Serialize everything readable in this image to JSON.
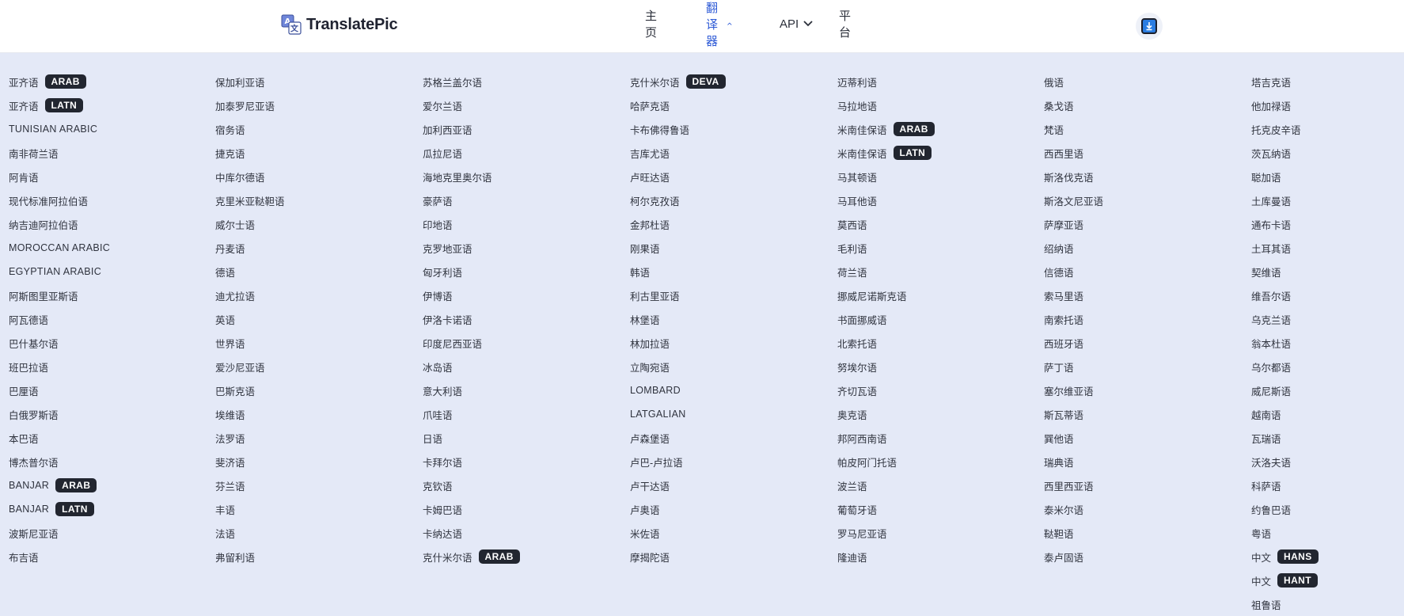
{
  "brand": {
    "name": "TranslatePic"
  },
  "nav": {
    "items": [
      {
        "label": "主页",
        "active": false,
        "chevron": ""
      },
      {
        "label": "翻译器",
        "active": true,
        "chevron": "⌃"
      },
      {
        "label": "API",
        "active": false,
        "chevron": "⌄"
      },
      {
        "label": "平台",
        "active": false,
        "chevron": ""
      }
    ],
    "download_icon": "download-icon"
  },
  "colors": {
    "accent": "#2f5bd6",
    "badge_bg": "#222630",
    "menu_bg": "#e4e9f7"
  },
  "columns": [
    [
      {
        "name": "亚齐语",
        "badge": "ARAB"
      },
      {
        "name": "亚齐语",
        "badge": "LATN"
      },
      {
        "name": "Tunisian Arabic",
        "badge": ""
      },
      {
        "name": "南非荷兰语",
        "badge": ""
      },
      {
        "name": "阿肯语",
        "badge": ""
      },
      {
        "name": "现代标准阿拉伯语",
        "badge": ""
      },
      {
        "name": "纳吉迪阿拉伯语",
        "badge": ""
      },
      {
        "name": "Moroccan Arabic",
        "badge": ""
      },
      {
        "name": "Egyptian Arabic",
        "badge": ""
      },
      {
        "name": "阿斯图里亚斯语",
        "badge": ""
      },
      {
        "name": "阿瓦德语",
        "badge": ""
      },
      {
        "name": "巴什基尔语",
        "badge": ""
      },
      {
        "name": "班巴拉语",
        "badge": ""
      },
      {
        "name": "巴厘语",
        "badge": ""
      },
      {
        "name": "白俄罗斯语",
        "badge": ""
      },
      {
        "name": "本巴语",
        "badge": ""
      },
      {
        "name": "博杰普尔语",
        "badge": ""
      },
      {
        "name": "Banjar",
        "badge": "ARAB"
      },
      {
        "name": "Banjar",
        "badge": "LATN"
      },
      {
        "name": "波斯尼亚语",
        "badge": ""
      },
      {
        "name": "布吉语",
        "badge": ""
      }
    ],
    [
      {
        "name": "保加利亚语",
        "badge": ""
      },
      {
        "name": "加泰罗尼亚语",
        "badge": ""
      },
      {
        "name": "宿务语",
        "badge": ""
      },
      {
        "name": "捷克语",
        "badge": ""
      },
      {
        "name": "中库尔德语",
        "badge": ""
      },
      {
        "name": "克里米亚鞑靼语",
        "badge": ""
      },
      {
        "name": "威尔士语",
        "badge": ""
      },
      {
        "name": "丹麦语",
        "badge": ""
      },
      {
        "name": "德语",
        "badge": ""
      },
      {
        "name": "迪尤拉语",
        "badge": ""
      },
      {
        "name": "英语",
        "badge": ""
      },
      {
        "name": "世界语",
        "badge": ""
      },
      {
        "name": "爱沙尼亚语",
        "badge": ""
      },
      {
        "name": "巴斯克语",
        "badge": ""
      },
      {
        "name": "埃维语",
        "badge": ""
      },
      {
        "name": "法罗语",
        "badge": ""
      },
      {
        "name": "斐济语",
        "badge": ""
      },
      {
        "name": "芬兰语",
        "badge": ""
      },
      {
        "name": "丰语",
        "badge": ""
      },
      {
        "name": "法语",
        "badge": ""
      },
      {
        "name": "弗留利语",
        "badge": ""
      }
    ],
    [
      {
        "name": "苏格兰盖尔语",
        "badge": ""
      },
      {
        "name": "爱尔兰语",
        "badge": ""
      },
      {
        "name": "加利西亚语",
        "badge": ""
      },
      {
        "name": "瓜拉尼语",
        "badge": ""
      },
      {
        "name": "海地克里奥尔语",
        "badge": ""
      },
      {
        "name": "豪萨语",
        "badge": ""
      },
      {
        "name": "印地语",
        "badge": ""
      },
      {
        "name": "克罗地亚语",
        "badge": ""
      },
      {
        "name": "匈牙利语",
        "badge": ""
      },
      {
        "name": "伊博语",
        "badge": ""
      },
      {
        "name": "伊洛卡诺语",
        "badge": ""
      },
      {
        "name": "印度尼西亚语",
        "badge": ""
      },
      {
        "name": "冰岛语",
        "badge": ""
      },
      {
        "name": "意大利语",
        "badge": ""
      },
      {
        "name": "爪哇语",
        "badge": ""
      },
      {
        "name": "日语",
        "badge": ""
      },
      {
        "name": "卡拜尔语",
        "badge": ""
      },
      {
        "name": "克钦语",
        "badge": ""
      },
      {
        "name": "卡姆巴语",
        "badge": ""
      },
      {
        "name": "卡纳达语",
        "badge": ""
      },
      {
        "name": "克什米尔语",
        "badge": "ARAB"
      }
    ],
    [
      {
        "name": "克什米尔语",
        "badge": "DEVA"
      },
      {
        "name": "哈萨克语",
        "badge": ""
      },
      {
        "name": "卡布佛得鲁语",
        "badge": ""
      },
      {
        "name": "吉库尤语",
        "badge": ""
      },
      {
        "name": "卢旺达语",
        "badge": ""
      },
      {
        "name": "柯尔克孜语",
        "badge": ""
      },
      {
        "name": "金邦杜语",
        "badge": ""
      },
      {
        "name": "刚果语",
        "badge": ""
      },
      {
        "name": "韩语",
        "badge": ""
      },
      {
        "name": "利古里亚语",
        "badge": ""
      },
      {
        "name": "林堡语",
        "badge": ""
      },
      {
        "name": "林加拉语",
        "badge": ""
      },
      {
        "name": "立陶宛语",
        "badge": ""
      },
      {
        "name": "Lombard",
        "badge": ""
      },
      {
        "name": "Latgalian",
        "badge": ""
      },
      {
        "name": "卢森堡语",
        "badge": ""
      },
      {
        "name": "卢巴-卢拉语",
        "badge": ""
      },
      {
        "name": "卢干达语",
        "badge": ""
      },
      {
        "name": "卢奥语",
        "badge": ""
      },
      {
        "name": "米佐语",
        "badge": ""
      },
      {
        "name": "摩揭陀语",
        "badge": ""
      }
    ],
    [
      {
        "name": "迈蒂利语",
        "badge": ""
      },
      {
        "name": "马拉地语",
        "badge": ""
      },
      {
        "name": "米南佳保语",
        "badge": "ARAB"
      },
      {
        "name": "米南佳保语",
        "badge": "LATN"
      },
      {
        "name": "马其顿语",
        "badge": ""
      },
      {
        "name": "马耳他语",
        "badge": ""
      },
      {
        "name": "莫西语",
        "badge": ""
      },
      {
        "name": "毛利语",
        "badge": ""
      },
      {
        "name": "荷兰语",
        "badge": ""
      },
      {
        "name": "挪威尼诺斯克语",
        "badge": ""
      },
      {
        "name": "书面挪威语",
        "badge": ""
      },
      {
        "name": "北索托语",
        "badge": ""
      },
      {
        "name": "努埃尔语",
        "badge": ""
      },
      {
        "name": "齐切瓦语",
        "badge": ""
      },
      {
        "name": "奥克语",
        "badge": ""
      },
      {
        "name": "邦阿西南语",
        "badge": ""
      },
      {
        "name": "帕皮阿门托语",
        "badge": ""
      },
      {
        "name": "波兰语",
        "badge": ""
      },
      {
        "name": "葡萄牙语",
        "badge": ""
      },
      {
        "name": "罗马尼亚语",
        "badge": ""
      },
      {
        "name": "隆迪语",
        "badge": ""
      }
    ],
    [
      {
        "name": "俄语",
        "badge": ""
      },
      {
        "name": "桑戈语",
        "badge": ""
      },
      {
        "name": "梵语",
        "badge": ""
      },
      {
        "name": "西西里语",
        "badge": ""
      },
      {
        "name": "斯洛伐克语",
        "badge": ""
      },
      {
        "name": "斯洛文尼亚语",
        "badge": ""
      },
      {
        "name": "萨摩亚语",
        "badge": ""
      },
      {
        "name": "绍纳语",
        "badge": ""
      },
      {
        "name": "信德语",
        "badge": ""
      },
      {
        "name": "索马里语",
        "badge": ""
      },
      {
        "name": "南索托语",
        "badge": ""
      },
      {
        "name": "西班牙语",
        "badge": ""
      },
      {
        "name": "萨丁语",
        "badge": ""
      },
      {
        "name": "塞尔维亚语",
        "badge": ""
      },
      {
        "name": "斯瓦蒂语",
        "badge": ""
      },
      {
        "name": "巽他语",
        "badge": ""
      },
      {
        "name": "瑞典语",
        "badge": ""
      },
      {
        "name": "西里西亚语",
        "badge": ""
      },
      {
        "name": "泰米尔语",
        "badge": ""
      },
      {
        "name": "鞑靼语",
        "badge": ""
      },
      {
        "name": "泰卢固语",
        "badge": ""
      }
    ],
    [
      {
        "name": "塔吉克语",
        "badge": ""
      },
      {
        "name": "他加禄语",
        "badge": ""
      },
      {
        "name": "托克皮辛语",
        "badge": ""
      },
      {
        "name": "茨瓦纳语",
        "badge": ""
      },
      {
        "name": "聪加语",
        "badge": ""
      },
      {
        "name": "土库曼语",
        "badge": ""
      },
      {
        "name": "通布卡语",
        "badge": ""
      },
      {
        "name": "土耳其语",
        "badge": ""
      },
      {
        "name": "契维语",
        "badge": ""
      },
      {
        "name": "维吾尔语",
        "badge": ""
      },
      {
        "name": "乌克兰语",
        "badge": ""
      },
      {
        "name": "翁本杜语",
        "badge": ""
      },
      {
        "name": "乌尔都语",
        "badge": ""
      },
      {
        "name": "威尼斯语",
        "badge": ""
      },
      {
        "name": "越南语",
        "badge": ""
      },
      {
        "name": "瓦瑞语",
        "badge": ""
      },
      {
        "name": "沃洛夫语",
        "badge": ""
      },
      {
        "name": "科萨语",
        "badge": ""
      },
      {
        "name": "约鲁巴语",
        "badge": ""
      },
      {
        "name": "粤语",
        "badge": ""
      },
      {
        "name": "中文",
        "badge": "HANS"
      },
      {
        "name": "中文",
        "badge": "HANT"
      },
      {
        "name": "祖鲁语",
        "badge": ""
      }
    ]
  ]
}
